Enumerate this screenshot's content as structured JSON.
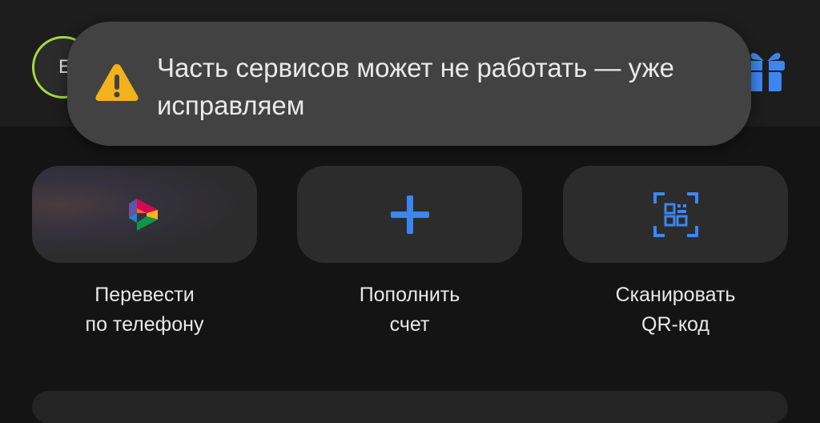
{
  "header": {
    "avatar_initial": "Е",
    "gift_icon": "gift-icon",
    "accent_color": "#a8d93a"
  },
  "toast": {
    "icon": "warning-icon",
    "line1": "Часть сервисов может не работать — уже",
    "line2": "исправляем"
  },
  "actions": [
    {
      "icon": "sbp-transfer-icon",
      "line1": "Перевести",
      "line2": "по телефону"
    },
    {
      "icon": "plus-icon",
      "line1": "Пополнить",
      "line2": "счет"
    },
    {
      "icon": "qr-scan-icon",
      "line1": "Сканировать",
      "line2": "QR-код"
    }
  ],
  "colors": {
    "icon_blue": "#3d86f0",
    "warning": "#f2b21b",
    "toast_bg": "#424242"
  }
}
